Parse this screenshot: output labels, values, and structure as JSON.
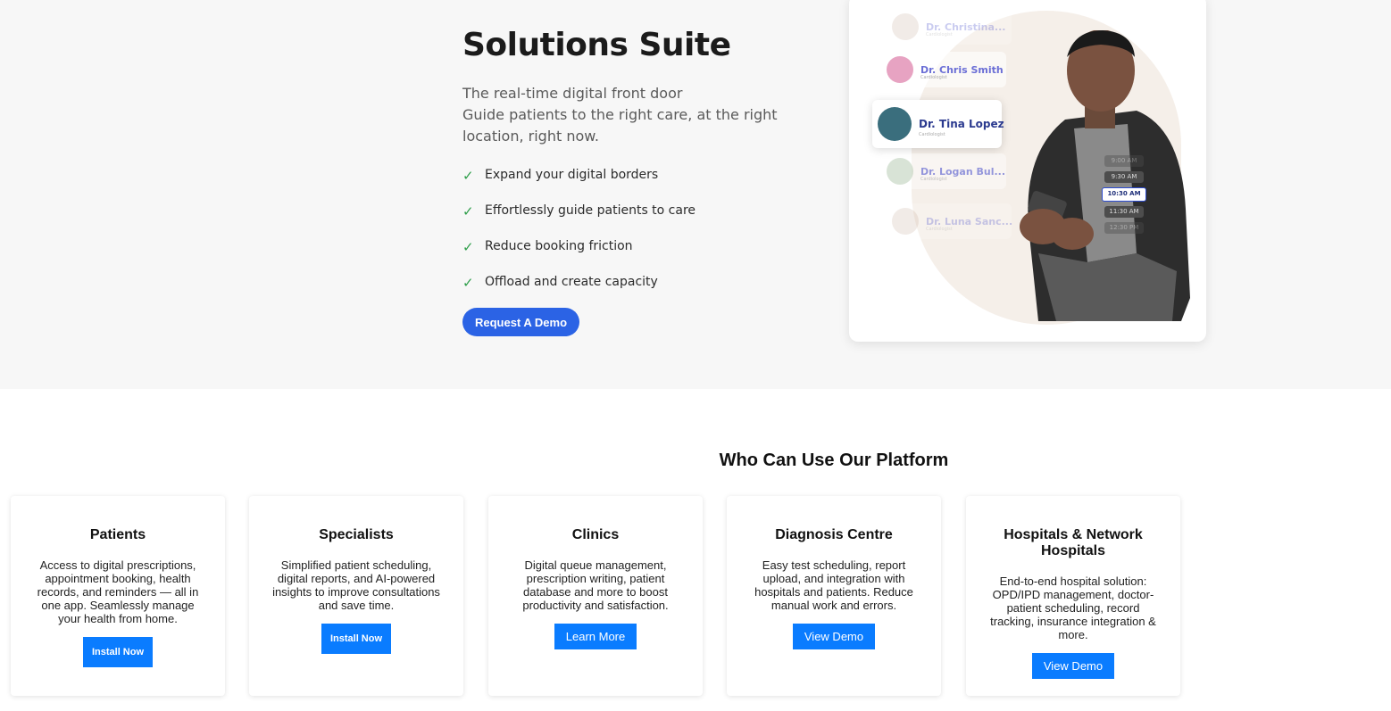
{
  "hero": {
    "title": "Solutions Suite",
    "subtitle_lines": [
      "The real-time digital front door",
      "Guide patients to the right care, at the right location, right now."
    ],
    "features": [
      "Expand your digital borders",
      "Effortlessly guide patients to care",
      "Reduce booking friction",
      "Offload and create capacity"
    ],
    "cta_label": "Request A Demo",
    "check_glyph": "✓"
  },
  "doctor_picker": {
    "doctors": [
      {
        "name": "Dr. Christina...",
        "role": "Cardiologist"
      },
      {
        "name": "Dr. Chris Smith",
        "role": "Cardiologist"
      },
      {
        "name": "Dr. Tina Lopez",
        "role": "Cardiologist"
      },
      {
        "name": "Dr. Logan Bul...",
        "role": "Cardiologist"
      },
      {
        "name": "Dr. Luna Sanc...",
        "role": "Cardiologist"
      }
    ],
    "time_slots": [
      "9:00 AM",
      "9:30 AM",
      "10:30 AM",
      "11:30 AM",
      "12:30 PM"
    ],
    "selected_slot": "10:30 AM"
  },
  "platform": {
    "title": "Who Can Use Our Platform",
    "cards": [
      {
        "title": "Patients",
        "text": "Access to digital prescriptions, appointment booking, health records, and reminders — all in one app. Seamlessly manage your health from home.",
        "button": "Install Now"
      },
      {
        "title": "Specialists",
        "text": "Simplified patient scheduling, digital reports, and AI-powered insights to improve consultations and save time.",
        "button": "Install Now"
      },
      {
        "title": "Clinics",
        "text": "Digital queue management, prescription writing, patient database and more to boost productivity and satisfaction.",
        "button": "Learn More"
      },
      {
        "title": "Diagnosis Centre",
        "text": "Easy test scheduling, report upload, and integration with hospitals and patients. Reduce manual work and errors.",
        "button": "View Demo"
      },
      {
        "title": "Hospitals & Network Hospitals",
        "text": "End-to-end hospital solution: OPD/IPD management, doctor-patient scheduling, record tracking, insurance integration & more.",
        "button": "View Demo"
      }
    ]
  },
  "colors": {
    "accent": "#2b63e5",
    "card_button": "#0a7cff",
    "check": "#2e9e4a"
  }
}
